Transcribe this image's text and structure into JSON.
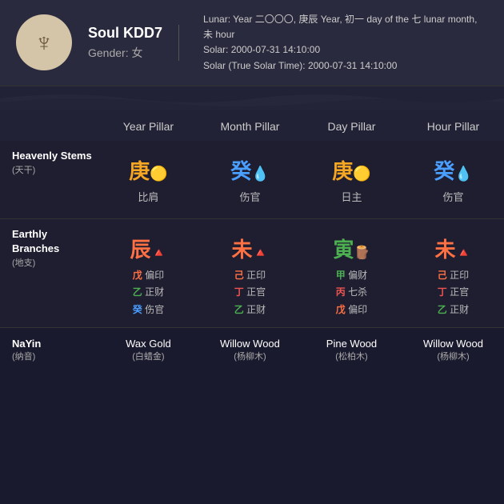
{
  "header": {
    "avatar_symbol": "♆",
    "name": "Soul KDD7",
    "gender_label": "Gender: 女",
    "lunar_line1": "Lunar: Year 二〇〇〇, 庚辰 Year, 初一 day of the 七 lunar month, 未 hour",
    "solar_line": "Solar: 2000-07-31 14:10:00",
    "solar_true_line": "Solar (True Solar Time): 2000-07-31 14:10:00"
  },
  "columns": {
    "row_label": "",
    "year": "Year Pillar",
    "month": "Month Pillar",
    "day": "Day Pillar",
    "hour": "Hour Pillar"
  },
  "heavenly_stems": {
    "section_label": "Heavenly Stems",
    "section_sub": "(天干)",
    "year": {
      "char": "庚",
      "color": "gold",
      "emoji": "🟡",
      "sub": "比肩"
    },
    "month": {
      "char": "癸",
      "color": "blue",
      "emoji": "💧",
      "sub": "伤官"
    },
    "day": {
      "char": "庚",
      "color": "gold",
      "emoji": "🟡",
      "sub": "日主"
    },
    "hour": {
      "char": "癸",
      "color": "blue",
      "emoji": "💧",
      "sub": "伤官"
    }
  },
  "earthly_branches": {
    "section_label": "Earthly Branches",
    "section_sub": "(地支)",
    "year": {
      "char": "辰",
      "color": "orange",
      "emoji": "🔺",
      "items": [
        {
          "char": "戊",
          "color": "orange",
          "label": "偏印"
        },
        {
          "char": "乙",
          "color": "green",
          "label": "正财"
        },
        {
          "char": "癸",
          "color": "blue",
          "label": "伤官"
        }
      ]
    },
    "month": {
      "char": "未",
      "color": "orange",
      "emoji": "🔺",
      "items": [
        {
          "char": "己",
          "color": "orange",
          "label": "正印"
        },
        {
          "char": "丁",
          "color": "red",
          "label": "正官"
        },
        {
          "char": "乙",
          "color": "green",
          "label": "正财"
        }
      ]
    },
    "day": {
      "char": "寅",
      "color": "green",
      "emoji": "🪵",
      "items": [
        {
          "char": "甲",
          "color": "green",
          "label": "偏财"
        },
        {
          "char": "丙",
          "color": "red",
          "label": "七杀"
        },
        {
          "char": "戊",
          "color": "orange",
          "label": "偏印"
        }
      ]
    },
    "hour": {
      "char": "未",
      "color": "orange",
      "emoji": "🔺",
      "items": [
        {
          "char": "己",
          "color": "orange",
          "label": "正印"
        },
        {
          "char": "丁",
          "color": "red",
          "label": "正官"
        },
        {
          "char": "乙",
          "color": "green",
          "label": "正财"
        }
      ]
    }
  },
  "nayin": {
    "section_label": "NaYin",
    "section_sub": "(纳音)",
    "year": {
      "value": "Wax Gold",
      "sub": "(白蜡金)"
    },
    "month": {
      "value": "Willow Wood",
      "sub": "(杨柳木)"
    },
    "day": {
      "value": "Pine Wood",
      "sub": "(松柏木)"
    },
    "hour": {
      "value": "Willow Wood",
      "sub": "(杨柳木)"
    }
  }
}
